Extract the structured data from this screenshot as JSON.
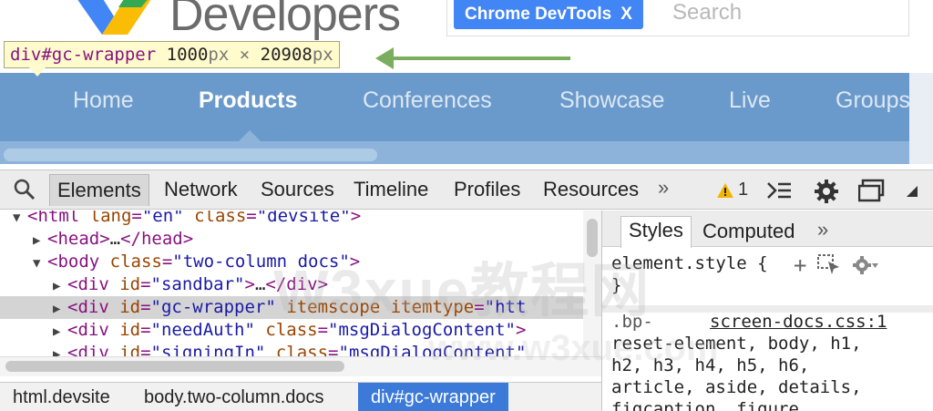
{
  "site": {
    "brand_text": "Developers",
    "search_chip_label": "Chrome DevTools",
    "search_chip_close": "X",
    "search_placeholder": "Search"
  },
  "inspect_tooltip": {
    "selector_tag": "div",
    "selector_id": "#gc-wrapper",
    "width_value": "1000",
    "width_unit": "px",
    "times": "×",
    "height_value": "20908",
    "height_unit": "px"
  },
  "nav": {
    "items": [
      {
        "label": "Home",
        "active": false
      },
      {
        "label": "Products",
        "active": true
      },
      {
        "label": "Conferences",
        "active": false
      },
      {
        "label": "Showcase",
        "active": false
      },
      {
        "label": "Live",
        "active": false
      },
      {
        "label": "Groups",
        "active": false
      }
    ]
  },
  "devtools": {
    "tabs": [
      "Elements",
      "Network",
      "Sources",
      "Timeline",
      "Profiles",
      "Resources"
    ],
    "active_tab": "Elements",
    "more": "»",
    "warning_count": "1"
  },
  "dom_tree": {
    "lines": [
      {
        "indent": 0,
        "arrow": "▼",
        "parts": [
          [
            "tg",
            "<html "
          ],
          [
            "at",
            "lang"
          ],
          [
            "tg",
            "="
          ],
          [
            "av",
            "\"en\""
          ],
          [
            "tg",
            " "
          ],
          [
            "at",
            "class"
          ],
          [
            "tg",
            "="
          ],
          [
            "av",
            "\"devsite\""
          ],
          [
            "tg",
            ">"
          ]
        ]
      },
      {
        "indent": 1,
        "arrow": "▶",
        "parts": [
          [
            "tg",
            "<head>"
          ],
          [
            "tx",
            "…"
          ],
          [
            "tg",
            "</head>"
          ]
        ]
      },
      {
        "indent": 1,
        "arrow": "▼",
        "parts": [
          [
            "tg",
            "<body "
          ],
          [
            "at",
            "class"
          ],
          [
            "tg",
            "="
          ],
          [
            "av",
            "\"two-column docs\""
          ],
          [
            "tg",
            ">"
          ]
        ]
      },
      {
        "indent": 2,
        "arrow": "▶",
        "parts": [
          [
            "tg",
            "<div "
          ],
          [
            "at",
            "id"
          ],
          [
            "tg",
            "="
          ],
          [
            "av",
            "\"sandbar\""
          ],
          [
            "tg",
            ">"
          ],
          [
            "tx",
            "…"
          ],
          [
            "tg",
            "</div>"
          ]
        ]
      },
      {
        "indent": 2,
        "arrow": "▶",
        "selected": true,
        "parts": [
          [
            "tg",
            "<div "
          ],
          [
            "at",
            "id"
          ],
          [
            "tg",
            "="
          ],
          [
            "av",
            "\"gc-wrapper\""
          ],
          [
            "tg",
            " "
          ],
          [
            "at",
            "itemscope"
          ],
          [
            "tg",
            " "
          ],
          [
            "at",
            "itemtype"
          ],
          [
            "tg",
            "="
          ],
          [
            "av",
            "\"htt"
          ]
        ]
      },
      {
        "indent": 2,
        "arrow": "▶",
        "parts": [
          [
            "tg",
            "<div "
          ],
          [
            "at",
            "id"
          ],
          [
            "tg",
            "="
          ],
          [
            "av",
            "\"needAuth\""
          ],
          [
            "tg",
            " "
          ],
          [
            "at",
            "class"
          ],
          [
            "tg",
            "="
          ],
          [
            "av",
            "\"msgDialogContent\""
          ],
          [
            "tg",
            ">"
          ]
        ]
      },
      {
        "indent": 2,
        "arrow": "▶",
        "parts": [
          [
            "tg",
            "<div "
          ],
          [
            "at",
            "id"
          ],
          [
            "tg",
            "="
          ],
          [
            "av",
            "\"signingIn\""
          ],
          [
            "tg",
            " "
          ],
          [
            "at",
            "class"
          ],
          [
            "tg",
            "="
          ],
          [
            "av",
            "\"msgDialogContent\""
          ]
        ]
      }
    ]
  },
  "breadcrumbs": [
    {
      "label": "html.devsite",
      "active": false
    },
    {
      "label": "body.two-column.docs",
      "active": false
    },
    {
      "label": "div#gc-wrapper",
      "active": true
    }
  ],
  "styles_panel": {
    "tabs": [
      "Styles",
      "Computed"
    ],
    "more": "»",
    "element_style_open": "element.style {",
    "element_style_close": "}",
    "rule_selector_start": ".bp-",
    "rule_source": "screen-docs.css:1",
    "rule_selector_lines": [
      "reset-element, body, h1,",
      "h2, h3, h4, h5, h6,",
      "article, aside, details,",
      "figcaption, figure,"
    ]
  },
  "watermark": {
    "line1": "W3xue教程网",
    "line2": "www.w3xue.com"
  },
  "colors": {
    "nav_blue": "#6a9acb",
    "nav_strip": "#8db3da",
    "selected_crumb": "#3b7ad9",
    "tooltip_bg": "#fffbcc",
    "arrow_green": "#7aae5e",
    "tag_purple": "#881280",
    "attr_brown": "#994500",
    "value_blue": "#1a1aa6"
  }
}
